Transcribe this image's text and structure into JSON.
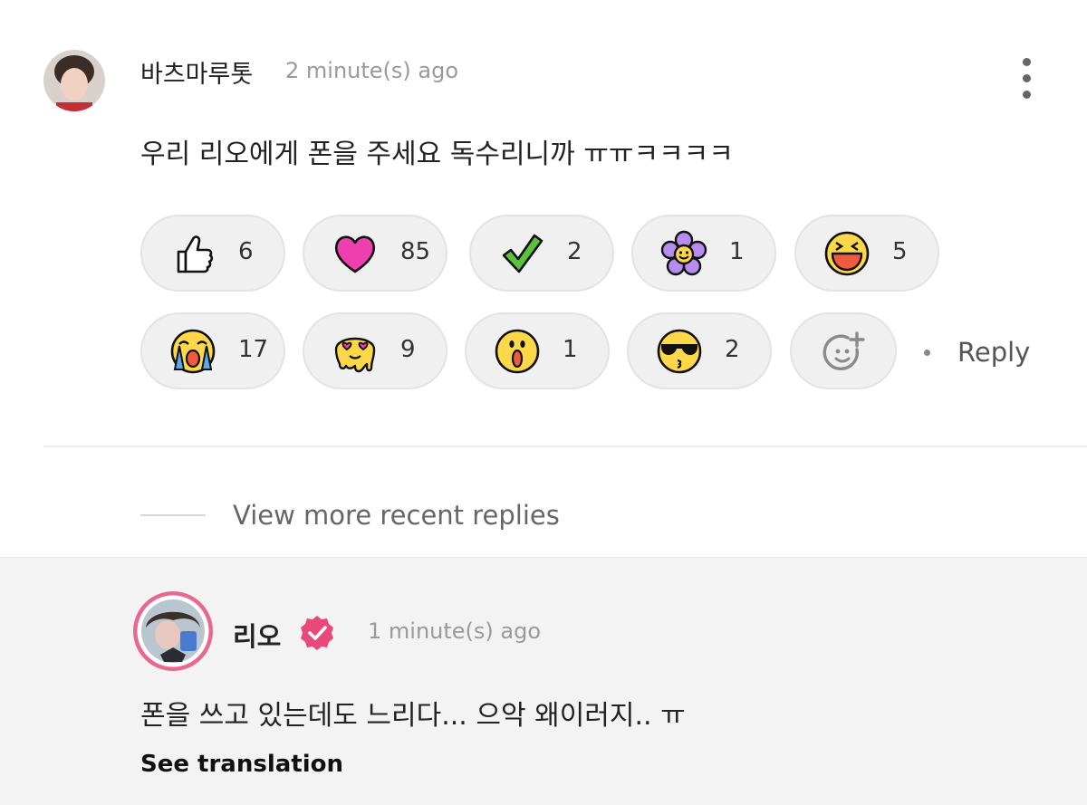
{
  "comment": {
    "username": "바츠마루톳",
    "timestamp": "2 minute(s) ago",
    "text": "우리 리오에게 폰을 주세요 독수리니까 ㅠㅠㅋㅋㅋㅋ",
    "reactions": [
      {
        "icon": "thumbs-up-icon",
        "count": "6"
      },
      {
        "icon": "heart-icon",
        "count": "85"
      },
      {
        "icon": "checkmark-icon",
        "count": "2"
      },
      {
        "icon": "flower-icon",
        "count": "1"
      },
      {
        "icon": "laughing-face-icon",
        "count": "5"
      },
      {
        "icon": "crying-face-icon",
        "count": "17"
      },
      {
        "icon": "melting-love-face-icon",
        "count": "9"
      },
      {
        "icon": "surprised-face-icon",
        "count": "1"
      },
      {
        "icon": "sunglasses-kiss-face-icon",
        "count": "2"
      }
    ],
    "add_reaction_icon": "add-reaction-icon",
    "reply_label": "Reply"
  },
  "view_more_label": "View more recent replies",
  "reply": {
    "username": "리오",
    "verified_icon": "verified-badge-icon",
    "timestamp": "1 minute(s) ago",
    "text": "폰을 쓰고 있는데도 느리다... 으악 왜이러지.. ㅠ",
    "see_translation_label": "See translation"
  },
  "colors": {
    "verified_badge": "#e8497a",
    "avatar_ring": "#e8698f",
    "pill_bg": "#f0f0f0"
  }
}
